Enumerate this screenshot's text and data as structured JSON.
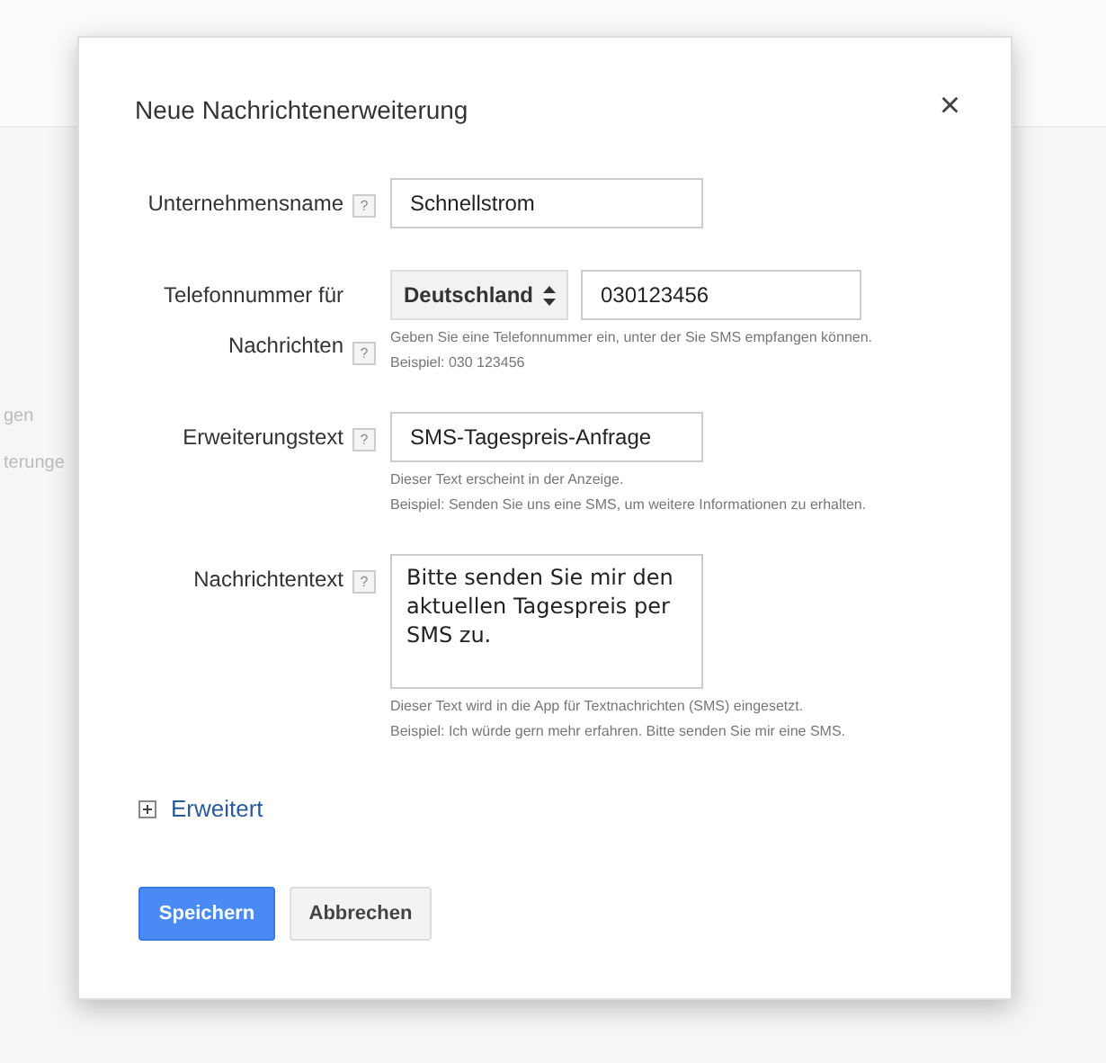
{
  "background": {
    "items": [
      "gen",
      "terunge"
    ]
  },
  "dialog": {
    "title": "Neue Nachrichtenerweiterung",
    "close": "×",
    "fields": [
      {
        "kind": "text",
        "label": "Unternehmensname",
        "help": "?",
        "value": "Schnellstrom"
      },
      {
        "kind": "phone",
        "label": "Telefonnummer für Nachrichten",
        "help": "?",
        "country": "Deutschland",
        "value": "030123456",
        "hints": [
          "Geben Sie eine Telefonnummer ein, unter der Sie SMS empfangen können.",
          "Beispiel: 030 123456"
        ]
      },
      {
        "kind": "text",
        "label": "Erweiterungstext",
        "help": "?",
        "value": "SMS-Tagespreis-Anfrage",
        "hints": [
          "Dieser Text erscheint in der Anzeige.",
          "Beispiel: Senden Sie uns eine SMS, um weitere Informationen zu erhalten."
        ]
      },
      {
        "kind": "textarea",
        "label": "Nachrichtentext",
        "help": "?",
        "value": "Bitte senden Sie mir den aktuellen Tagespreis per SMS zu.",
        "hints": [
          "Dieser Text wird in die App für Textnachrichten (SMS) eingesetzt.",
          "Beispiel: Ich würde gern mehr erfahren. Bitte senden Sie mir eine SMS."
        ]
      }
    ],
    "advanced": {
      "label": "Erweitert",
      "expanded": false
    },
    "buttons": [
      {
        "kind": "primary",
        "label": "Speichern"
      },
      {
        "kind": "secondary",
        "label": "Abbrechen"
      }
    ]
  }
}
